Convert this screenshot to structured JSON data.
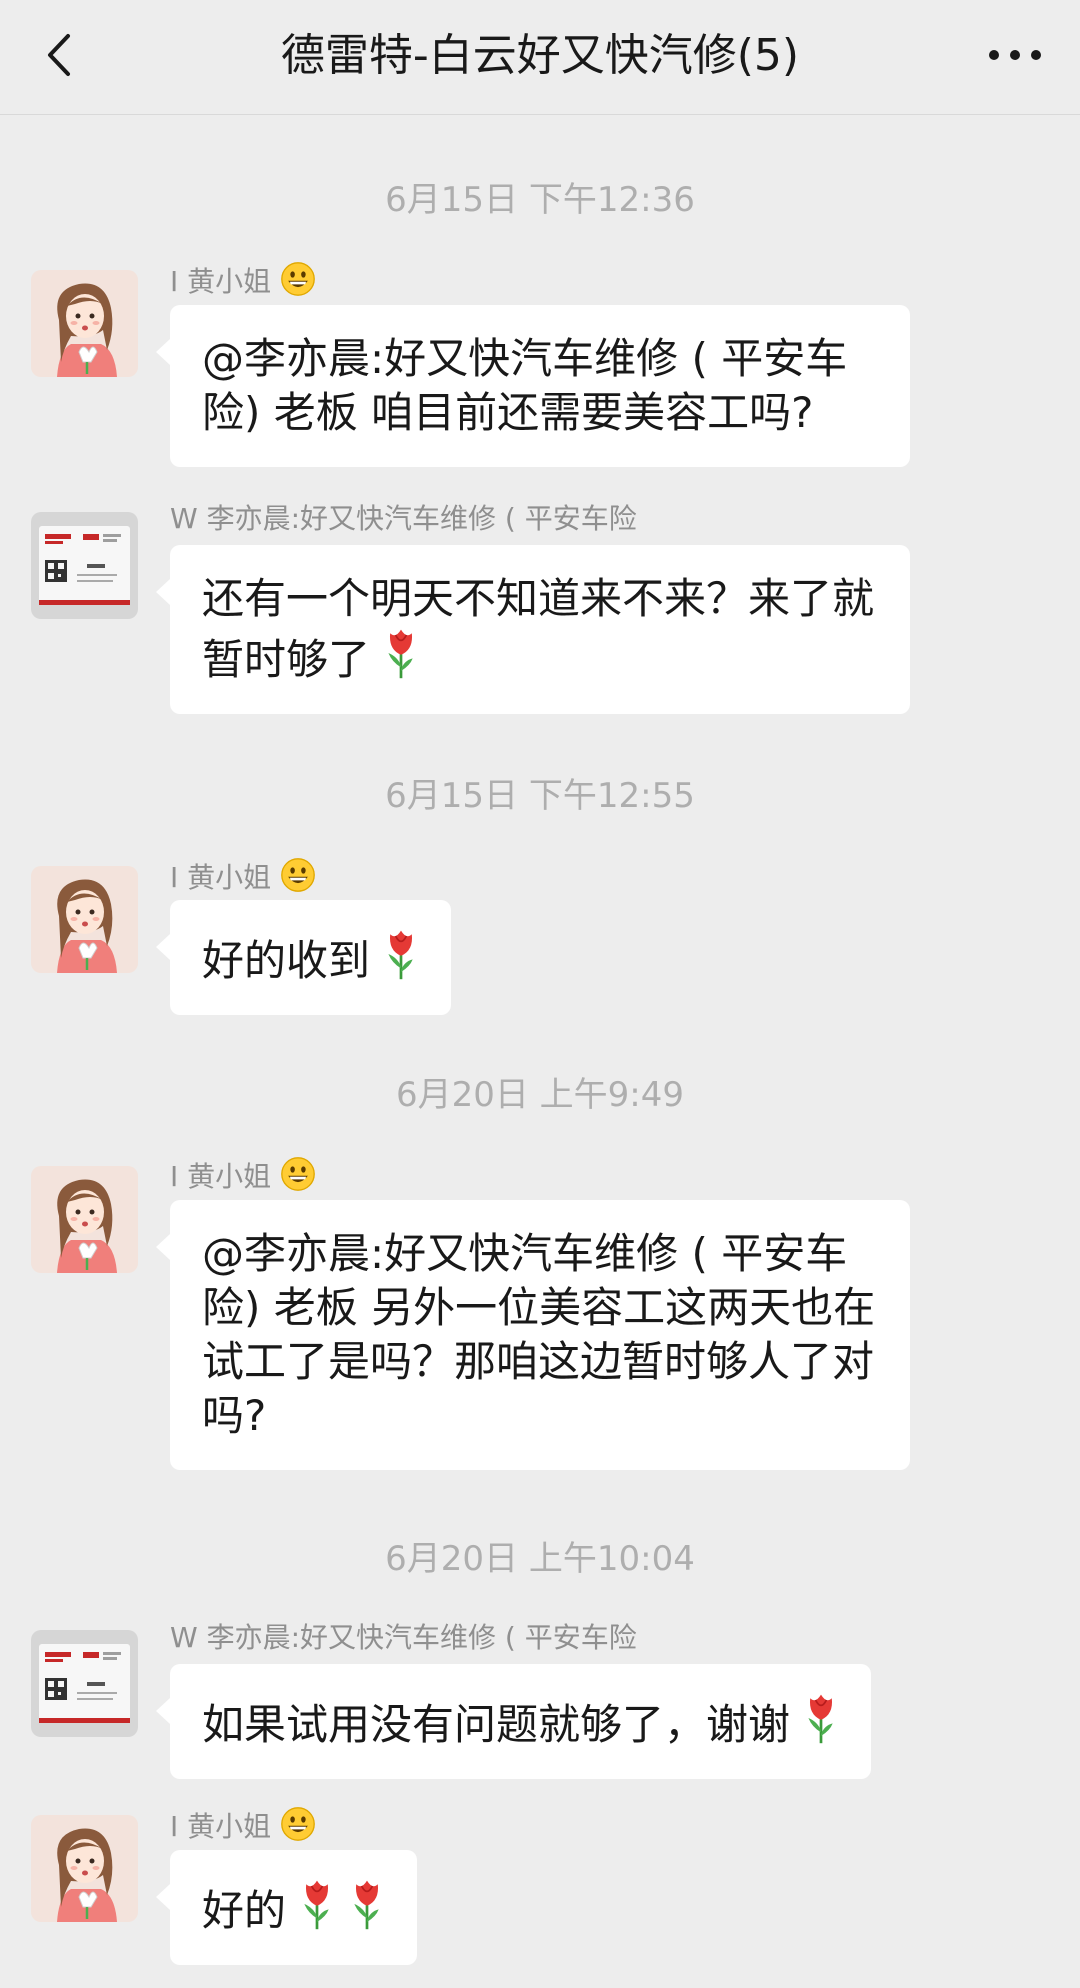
{
  "header": {
    "title": "德雷特-白云好又快汽修(5)",
    "back_icon": "chevron-left-icon",
    "more_icon": "ellipsis-icon"
  },
  "messages": [
    {
      "timestamp": "6月15日 下午12:36",
      "sender": "I 黄小姐",
      "sender_emoji": "grinning-face-icon",
      "avatar": "girl-with-flowers-avatar",
      "text": "@李亦晨:好又快汽车维修 ( 平安车险) 老板 咱目前还需要美容工吗?"
    },
    {
      "sender": "W 李亦晨:好又快汽车维修 ( 平安车险",
      "avatar": "business-card-avatar",
      "text": "还有一个明天不知道来不来？来了就暂时够了",
      "emoji": "tulip-icon"
    },
    {
      "timestamp": "6月15日 下午12:55",
      "sender": "I 黄小姐",
      "sender_emoji": "grinning-face-icon",
      "avatar": "girl-with-flowers-avatar",
      "text": "好的收到",
      "emoji": "tulip-icon"
    },
    {
      "timestamp": "6月20日 上午9:49",
      "sender": "I 黄小姐",
      "sender_emoji": "grinning-face-icon",
      "avatar": "girl-with-flowers-avatar",
      "text": "@李亦晨:好又快汽车维修 ( 平安车险) 老板 另外一位美容工这两天也在试工了是吗？那咱这边暂时够人了对吗?"
    },
    {
      "timestamp": "6月20日 上午10:04",
      "sender": "W 李亦晨:好又快汽车维修 ( 平安车险",
      "avatar": "business-card-avatar",
      "text": "如果试用没有问题就够了，谢谢",
      "emoji": "tulip-icon"
    },
    {
      "sender": "I 黄小姐",
      "sender_emoji": "grinning-face-icon",
      "avatar": "girl-with-flowers-avatar",
      "text": "好的",
      "emoji": "tulip-icon",
      "emoji_count": 2
    }
  ],
  "colors": {
    "background": "#ededed",
    "bubble": "#ffffff",
    "timestamp": "#aeaeae",
    "sender": "#8f8f8f",
    "text": "#191919"
  }
}
